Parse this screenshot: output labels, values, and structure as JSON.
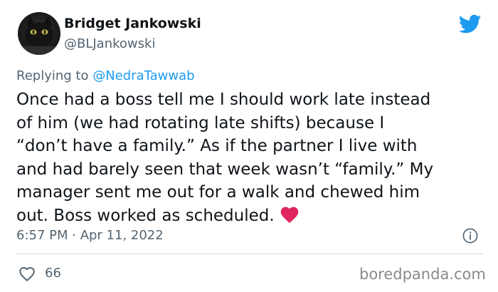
{
  "author": {
    "display_name": "Bridget Jankowski",
    "handle": "@BLJankowski",
    "avatar_icon": "black-cat-avatar"
  },
  "reply": {
    "prefix": "Replying to ",
    "mention": "@NedraTawwab"
  },
  "tweet": {
    "text": "Once had a boss tell me I should work late instead\nof him (we had rotating late shifts) because I\n“don’t have a family.” As if the partner I live with\nand had barely seen that week wasn’t “family.” My\nmanager sent me out for a walk and chewed him\nout. Boss worked as scheduled.",
    "emoji": "red-heart-emoji",
    "timestamp": "6:57 PM · Apr 11, 2022"
  },
  "engagement": {
    "likes": "66"
  },
  "watermark": "boredpanda.com",
  "colors": {
    "twitter_blue": "#1d9bf0",
    "secondary_text": "#536471",
    "heart_red": "#e0245e"
  }
}
